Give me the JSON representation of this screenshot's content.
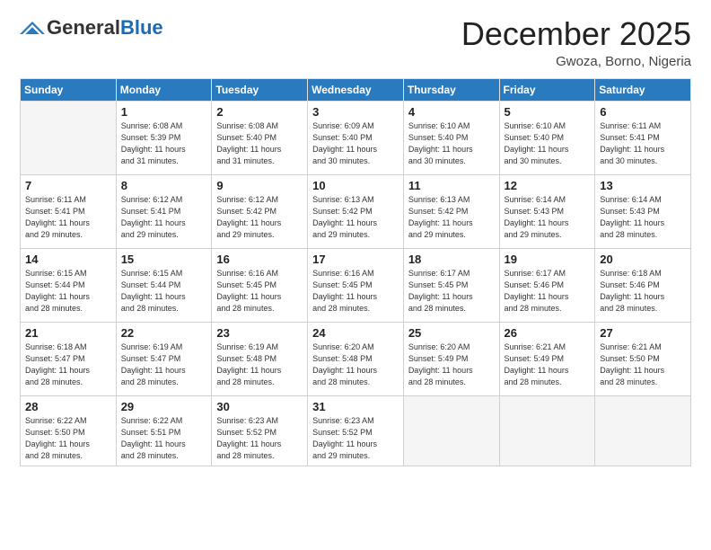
{
  "logo": {
    "general": "General",
    "blue": "Blue",
    "tagline": "GeneralBlue"
  },
  "header": {
    "month": "December 2025",
    "location": "Gwoza, Borno, Nigeria"
  },
  "days": {
    "headers": [
      "Sunday",
      "Monday",
      "Tuesday",
      "Wednesday",
      "Thursday",
      "Friday",
      "Saturday"
    ]
  },
  "weeks": [
    {
      "cells": [
        {
          "num": "",
          "text": ""
        },
        {
          "num": "1",
          "text": "Sunrise: 6:08 AM\nSunset: 5:39 PM\nDaylight: 11 hours\nand 31 minutes."
        },
        {
          "num": "2",
          "text": "Sunrise: 6:08 AM\nSunset: 5:40 PM\nDaylight: 11 hours\nand 31 minutes."
        },
        {
          "num": "3",
          "text": "Sunrise: 6:09 AM\nSunset: 5:40 PM\nDaylight: 11 hours\nand 30 minutes."
        },
        {
          "num": "4",
          "text": "Sunrise: 6:10 AM\nSunset: 5:40 PM\nDaylight: 11 hours\nand 30 minutes."
        },
        {
          "num": "5",
          "text": "Sunrise: 6:10 AM\nSunset: 5:40 PM\nDaylight: 11 hours\nand 30 minutes."
        },
        {
          "num": "6",
          "text": "Sunrise: 6:11 AM\nSunset: 5:41 PM\nDaylight: 11 hours\nand 30 minutes."
        }
      ]
    },
    {
      "cells": [
        {
          "num": "7",
          "text": "Sunrise: 6:11 AM\nSunset: 5:41 PM\nDaylight: 11 hours\nand 29 minutes."
        },
        {
          "num": "8",
          "text": "Sunrise: 6:12 AM\nSunset: 5:41 PM\nDaylight: 11 hours\nand 29 minutes."
        },
        {
          "num": "9",
          "text": "Sunrise: 6:12 AM\nSunset: 5:42 PM\nDaylight: 11 hours\nand 29 minutes."
        },
        {
          "num": "10",
          "text": "Sunrise: 6:13 AM\nSunset: 5:42 PM\nDaylight: 11 hours\nand 29 minutes."
        },
        {
          "num": "11",
          "text": "Sunrise: 6:13 AM\nSunset: 5:42 PM\nDaylight: 11 hours\nand 29 minutes."
        },
        {
          "num": "12",
          "text": "Sunrise: 6:14 AM\nSunset: 5:43 PM\nDaylight: 11 hours\nand 29 minutes."
        },
        {
          "num": "13",
          "text": "Sunrise: 6:14 AM\nSunset: 5:43 PM\nDaylight: 11 hours\nand 28 minutes."
        }
      ]
    },
    {
      "cells": [
        {
          "num": "14",
          "text": "Sunrise: 6:15 AM\nSunset: 5:44 PM\nDaylight: 11 hours\nand 28 minutes."
        },
        {
          "num": "15",
          "text": "Sunrise: 6:15 AM\nSunset: 5:44 PM\nDaylight: 11 hours\nand 28 minutes."
        },
        {
          "num": "16",
          "text": "Sunrise: 6:16 AM\nSunset: 5:45 PM\nDaylight: 11 hours\nand 28 minutes."
        },
        {
          "num": "17",
          "text": "Sunrise: 6:16 AM\nSunset: 5:45 PM\nDaylight: 11 hours\nand 28 minutes."
        },
        {
          "num": "18",
          "text": "Sunrise: 6:17 AM\nSunset: 5:45 PM\nDaylight: 11 hours\nand 28 minutes."
        },
        {
          "num": "19",
          "text": "Sunrise: 6:17 AM\nSunset: 5:46 PM\nDaylight: 11 hours\nand 28 minutes."
        },
        {
          "num": "20",
          "text": "Sunrise: 6:18 AM\nSunset: 5:46 PM\nDaylight: 11 hours\nand 28 minutes."
        }
      ]
    },
    {
      "cells": [
        {
          "num": "21",
          "text": "Sunrise: 6:18 AM\nSunset: 5:47 PM\nDaylight: 11 hours\nand 28 minutes."
        },
        {
          "num": "22",
          "text": "Sunrise: 6:19 AM\nSunset: 5:47 PM\nDaylight: 11 hours\nand 28 minutes."
        },
        {
          "num": "23",
          "text": "Sunrise: 6:19 AM\nSunset: 5:48 PM\nDaylight: 11 hours\nand 28 minutes."
        },
        {
          "num": "24",
          "text": "Sunrise: 6:20 AM\nSunset: 5:48 PM\nDaylight: 11 hours\nand 28 minutes."
        },
        {
          "num": "25",
          "text": "Sunrise: 6:20 AM\nSunset: 5:49 PM\nDaylight: 11 hours\nand 28 minutes."
        },
        {
          "num": "26",
          "text": "Sunrise: 6:21 AM\nSunset: 5:49 PM\nDaylight: 11 hours\nand 28 minutes."
        },
        {
          "num": "27",
          "text": "Sunrise: 6:21 AM\nSunset: 5:50 PM\nDaylight: 11 hours\nand 28 minutes."
        }
      ]
    },
    {
      "cells": [
        {
          "num": "28",
          "text": "Sunrise: 6:22 AM\nSunset: 5:50 PM\nDaylight: 11 hours\nand 28 minutes."
        },
        {
          "num": "29",
          "text": "Sunrise: 6:22 AM\nSunset: 5:51 PM\nDaylight: 11 hours\nand 28 minutes."
        },
        {
          "num": "30",
          "text": "Sunrise: 6:23 AM\nSunset: 5:52 PM\nDaylight: 11 hours\nand 28 minutes."
        },
        {
          "num": "31",
          "text": "Sunrise: 6:23 AM\nSunset: 5:52 PM\nDaylight: 11 hours\nand 29 minutes."
        },
        {
          "num": "",
          "text": ""
        },
        {
          "num": "",
          "text": ""
        },
        {
          "num": "",
          "text": ""
        }
      ]
    }
  ]
}
